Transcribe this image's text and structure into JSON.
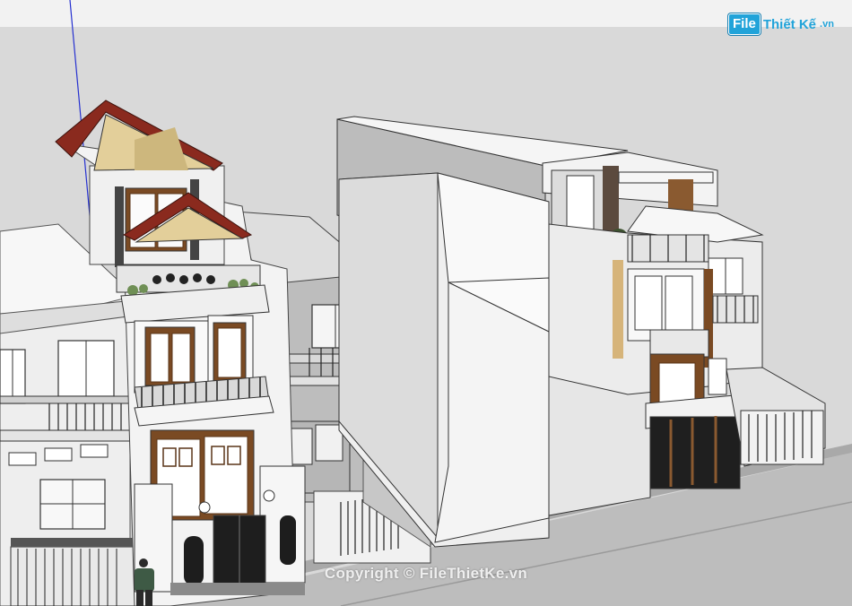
{
  "branding": {
    "logo_mark": "File",
    "logo_name": "Thiết Kế",
    "logo_tld": ".vn",
    "watermark": "Copyright © FileThietKe.vn"
  },
  "colors": {
    "sky": "#f2f2f2",
    "ground": "#dadada",
    "road": "#bcbcbc",
    "wall_white": "#f4f4f4",
    "wall_grey": "#c8c8c8",
    "roof_tile": "#8a2a1e",
    "gable_beige": "#e3cf9a",
    "wood": "#7a4a23",
    "brand_blue": "#21a3d9",
    "axis_blue": "#2530d0",
    "axis_green": "#2e9e3a"
  }
}
